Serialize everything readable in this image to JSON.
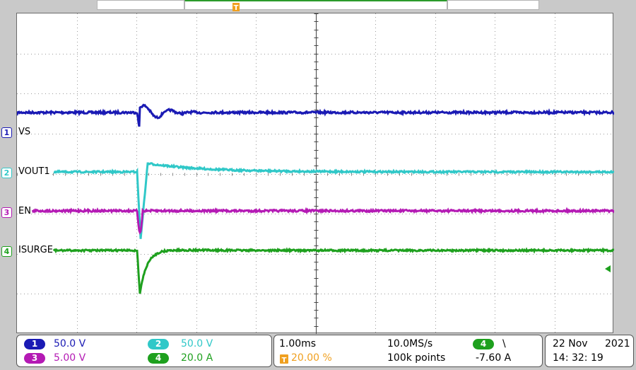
{
  "colors": {
    "ch1": "#1a1ab4",
    "ch2": "#30c8c8",
    "ch3": "#b41ab4",
    "ch4": "#1ea01e",
    "trigger": "#f0a020"
  },
  "channels": [
    {
      "num": "1",
      "label": "VS",
      "scale": "50.0 V"
    },
    {
      "num": "2",
      "label": "VOUT1",
      "scale": "50.0 V"
    },
    {
      "num": "3",
      "label": "EN",
      "scale": "5.00 V"
    },
    {
      "num": "4",
      "label": "ISURGE",
      "scale": "20.0 A"
    }
  ],
  "trigger_marker": "T",
  "timebase": {
    "time_div": "1.00ms",
    "sample_rate": "10.0MS/s",
    "trigger_pos": "20.00 %",
    "record_length": "100k points",
    "trigger_channel": "4",
    "trigger_slope_icon": "falling-edge-icon",
    "trigger_slope_glyph": "\\",
    "trigger_level": "-7.60 A"
  },
  "datetime": {
    "date": "22 Nov",
    "year": "2021",
    "time": "14: 32: 19"
  }
}
